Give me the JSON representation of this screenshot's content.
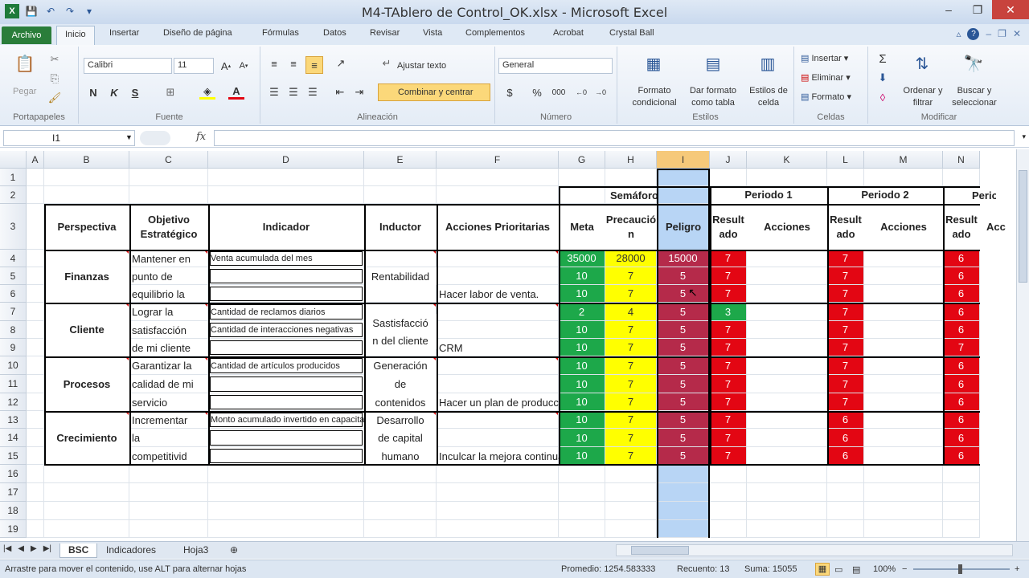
{
  "window": {
    "title": "M4-TAblero de Control_OK.xlsx - Microsoft Excel",
    "minimize": "–",
    "restore": "❐",
    "close": "✕"
  },
  "qat": {
    "save": "💾",
    "undo": "↶",
    "redo": "↷",
    "more": "▾"
  },
  "tabs": [
    "Archivo",
    "Inicio",
    "Insertar",
    "Diseño de página",
    "Fórmulas",
    "Datos",
    "Revisar",
    "Vista",
    "Complementos",
    "Acrobat",
    "Crystal Ball"
  ],
  "ribbon": {
    "portapapeles": {
      "label": "Portapapeles",
      "pegar": "Pegar"
    },
    "fuente": {
      "label": "Fuente",
      "font": "Calibri",
      "size": "11",
      "bold": "N",
      "italic": "K",
      "underline": "S"
    },
    "alineacion": {
      "label": "Alineación",
      "ajustar": "Ajustar texto",
      "combinar": "Combinar y centrar"
    },
    "numero": {
      "label": "Número",
      "format": "General",
      "currency": "$",
      "percent": "%",
      "thousands": "000"
    },
    "estilos": {
      "label": "Estilos",
      "formato_cond": "Formato condicional",
      "dar_formato": "Dar formato como tabla",
      "estilos_celda": "Estilos de celda"
    },
    "celdas": {
      "label": "Celdas",
      "insertar": "Insertar",
      "eliminar": "Eliminar",
      "formato": "Formato"
    },
    "modificar": {
      "label": "Modificar",
      "sigma": "Σ",
      "ordenar": "Ordenar y filtrar",
      "buscar": "Buscar y seleccionar"
    }
  },
  "formula_bar": {
    "name_box": "I1",
    "fx": "fx",
    "value": ""
  },
  "columns": [
    "A",
    "B",
    "C",
    "D",
    "E",
    "F",
    "G",
    "H",
    "I",
    "J",
    "K",
    "L",
    "M",
    "N"
  ],
  "rows": [
    "1",
    "2",
    "3",
    "4",
    "5",
    "6",
    "7",
    "8",
    "9",
    "10",
    "11",
    "12",
    "13",
    "14",
    "15",
    "16",
    "17",
    "18",
    "19"
  ],
  "sheet": {
    "semaforo": "Semáforo",
    "periodo1": "Periodo 1",
    "periodo2": "Periodo 2",
    "periodo3": "Period",
    "h_perspectiva": "Perspectiva",
    "h_objetivo": "Objetivo Estratégico",
    "h_indicador": "Indicador",
    "h_inductor": "Inductor",
    "h_acciones_prio": "Acciones Prioritarias",
    "h_meta": "Meta",
    "h_precaucion": "Precaución",
    "h_peligro": "Peligro",
    "h_resultado": "Resultado",
    "h_acciones": "Acciones",
    "h_acciones_cut": "Acc",
    "perspectivas": [
      "Finanzas",
      "Cliente",
      "Procesos",
      "Crecimiento"
    ],
    "objetivos": [
      [
        "Mantener en",
        "punto de",
        "equilibrio la"
      ],
      [
        "Lograr la",
        "satisfacción",
        "de mi cliente"
      ],
      [
        "Garantizar la",
        "calidad de mi",
        "servicio"
      ],
      [
        "Incrementar",
        "la",
        "competitivid"
      ]
    ],
    "indicadores": [
      "Venta acumulada del mes",
      "Cantidad de reclamos diarios",
      "Cantidad de interacciones negativas",
      "Cantidad de artículos producidos",
      "Monto acumulado invertido en capacitación"
    ],
    "inductores": [
      [
        "Rentabilidad"
      ],
      [
        "Sastisfacció",
        "n del cliente"
      ],
      [
        "Generación",
        "de",
        "contenidos"
      ],
      [
        "Desarrollo",
        "de capital",
        "humano"
      ]
    ],
    "acciones_prio": [
      "Hacer labor de venta.",
      "CRM",
      "Hacer un plan de producción",
      "Inculcar la mejora continua"
    ],
    "meta": [
      "35000",
      "10",
      "10",
      "2",
      "10",
      "10",
      "10",
      "10",
      "10",
      "10",
      "10",
      "10"
    ],
    "precaucion": [
      "28000",
      "7",
      "7",
      "4",
      "7",
      "7",
      "7",
      "7",
      "7",
      "7",
      "7",
      "7"
    ],
    "peligro": [
      "15000",
      "5",
      "5",
      "5",
      "5",
      "5",
      "5",
      "5",
      "5",
      "5",
      "5",
      "5"
    ],
    "resultado1": [
      "7",
      "7",
      "7",
      "3",
      "7",
      "7",
      "7",
      "7",
      "7",
      "7",
      "7",
      "7"
    ],
    "resultado2": [
      "7",
      "7",
      "7",
      "7",
      "7",
      "7",
      "7",
      "7",
      "7",
      "6",
      "6",
      "6"
    ],
    "resultado3": [
      "6",
      "6",
      "6",
      "6",
      "6",
      "7",
      "6",
      "6",
      "6",
      "6",
      "6",
      "6"
    ]
  },
  "sheet_tabs": [
    "BSC",
    "Indicadores",
    "Hoja3"
  ],
  "status": {
    "message": "Arrastre para mover el contenido, use ALT para alternar hojas",
    "promedio": "Promedio: 1254.583333",
    "recuento": "Recuento: 13",
    "suma": "Suma: 15055",
    "zoom": "100%",
    "minus": "−",
    "plus": "+"
  },
  "colors": {
    "green": "#1da84a",
    "yellow": "#ffff00",
    "red": "#e30613",
    "crimson": "#b52a4a",
    "selection": "#b8d5f5",
    "file_tab": "#2a7d3a"
  }
}
